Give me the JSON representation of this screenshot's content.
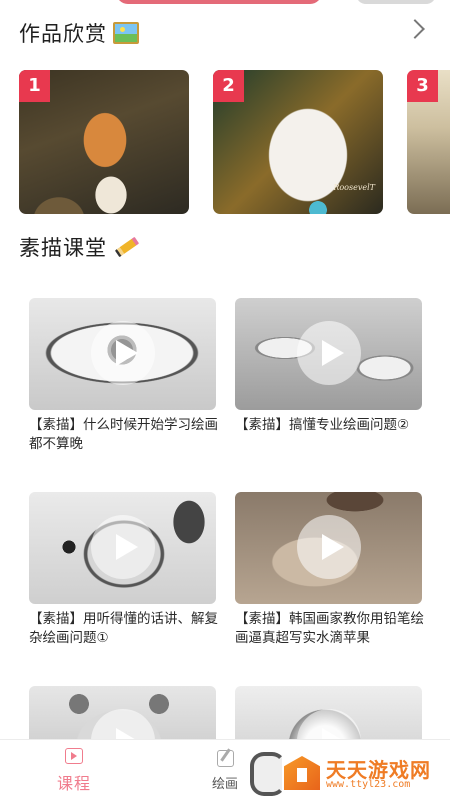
{
  "gallery": {
    "title": "作品欣赏",
    "ranks": [
      "1",
      "2",
      "3"
    ],
    "art2_signature": "RoosevelT"
  },
  "sketch": {
    "title": "素描课堂",
    "videos": [
      "【素描】什么时候开始学习绘画都不算晚",
      "【素描】搞懂专业绘画问题②",
      "【素描】用听得懂的话讲、解复杂绘画问题①",
      "【素描】韩国画家教你用铅笔绘画逼真超写实水滴苹果"
    ]
  },
  "nav": {
    "courses": "课程",
    "draw": "绘画"
  },
  "watermark": {
    "text": "天天游戏网",
    "url": "www.ttyl23.com"
  },
  "colors": {
    "accent": "#e8394f",
    "nav_active": "#f07c8d",
    "watermark": "#ef7c25"
  }
}
